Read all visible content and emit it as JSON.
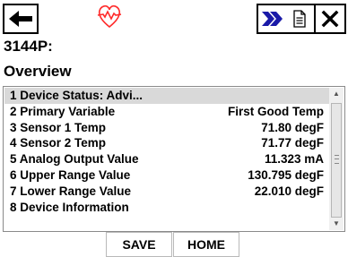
{
  "toolbar": {
    "back_icon": "arrow-left-icon",
    "status_icon": "broken-heart-icon",
    "status_color": "#ff2a2a",
    "forward_icon": "double-chevron-right-icon",
    "forward_color": "#1a1aa8",
    "doc_icon": "document-icon",
    "close_icon": "close-icon"
  },
  "header": {
    "device_tag": "3144P:",
    "title": "Overview"
  },
  "menu": {
    "items": [
      {
        "label": "1 Device Status: Advi...",
        "value": ""
      },
      {
        "label": "2 Primary Variable",
        "value": "First Good Temp"
      },
      {
        "label": "3 Sensor 1 Temp",
        "value": "71.80 degF"
      },
      {
        "label": "4 Sensor 2 Temp",
        "value": "71.77 degF"
      },
      {
        "label": "5 Analog Output Value",
        "value": "11.323 mA"
      },
      {
        "label": "6 Upper Range Value",
        "value": "130.795 degF"
      },
      {
        "label": "7 Lower Range Value",
        "value": "22.010 degF"
      },
      {
        "label": "8 Device Information",
        "value": ""
      }
    ]
  },
  "softkeys": {
    "save_label": "SAVE",
    "home_label": "HOME"
  }
}
